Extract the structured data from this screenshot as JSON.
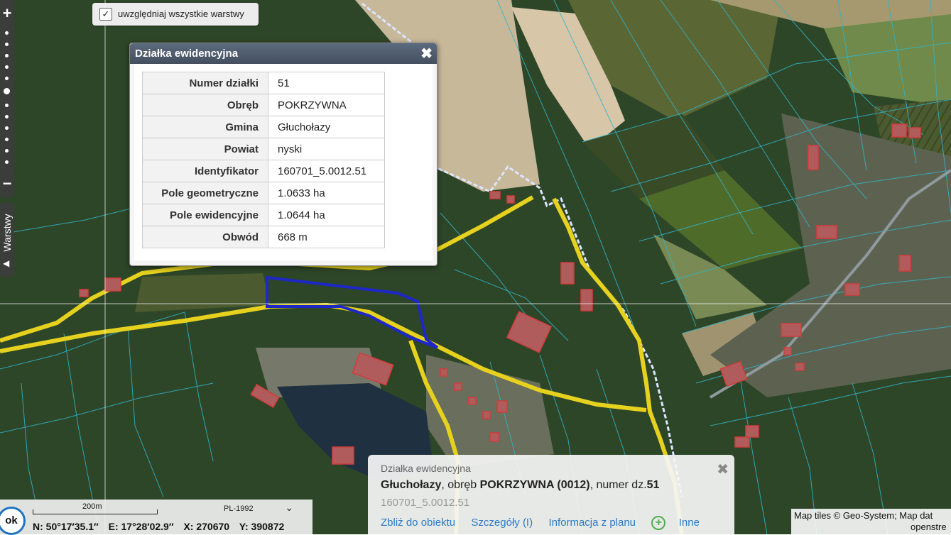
{
  "map": {
    "zoom_in_label": "+",
    "zoom_out_label": "−",
    "layers_tab_label": "Warstwy",
    "layers_tab_arrow": "◀",
    "all_layers_checkbox": {
      "checked": true,
      "label": "uwzględniaj wszystkie warstwy"
    },
    "colors": {
      "parcel_lines": "#32b4c8",
      "road": "#e6d21e",
      "selected_parcel": "#1e28c8",
      "buildings": "#d23c3c",
      "boundary": "#dce6ff"
    }
  },
  "popup": {
    "title": "Działka ewidencyjna",
    "close_icon": "close-icon",
    "rows": [
      {
        "label": "Numer działki",
        "value": "51"
      },
      {
        "label": "Obręb",
        "value": "POKRZYWNA"
      },
      {
        "label": "Gmina",
        "value": "Głuchołazy"
      },
      {
        "label": "Powiat",
        "value": "nyski"
      },
      {
        "label": "Identyfikator",
        "value": "160701_5.0012.51"
      },
      {
        "label": "Pole geometryczne",
        "value": "1.0633 ha"
      },
      {
        "label": "Pole ewidencyjne",
        "value": "1.0644 ha"
      },
      {
        "label": "Obwód",
        "value": "668 m"
      }
    ]
  },
  "info": {
    "title": "Działka ewidencyjna",
    "gmina": "Głuchołazy",
    "sep1": ", obręb ",
    "obreb": "POKRZYWNA (0012)",
    "sep2": ", numer dz.",
    "numer": "51",
    "identifier": "160701_5.0012.51",
    "links": {
      "zoom": "Zbliż do obiektu",
      "details": "Szczegóły (I)",
      "plan": "Informacja z planu",
      "other": "Inne"
    }
  },
  "status": {
    "ok_label": "ok",
    "scale_label": "200m",
    "crs": "PL-1992",
    "N": "N: 50°17′35.1″",
    "E": "E: 17°28′02.9″",
    "X": "X: 270670",
    "Y": "Y: 390872"
  },
  "attribution": {
    "line1": "Map tiles © Geo-System; Map dat",
    "line2": "openstre"
  }
}
